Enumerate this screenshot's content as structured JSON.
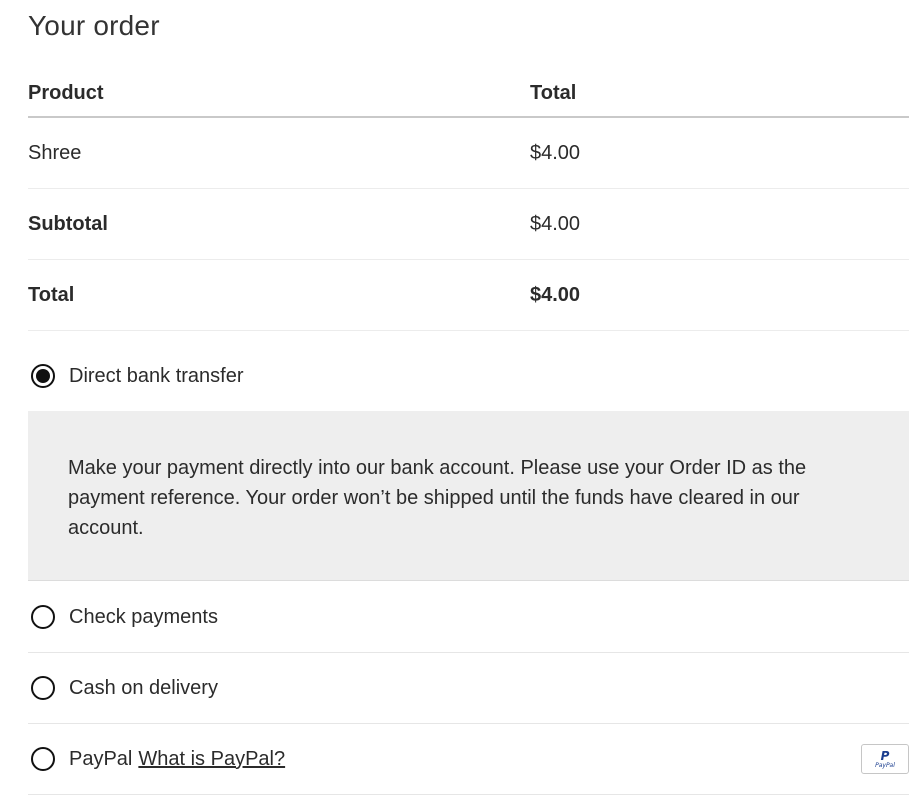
{
  "section_title": "Your order",
  "table": {
    "headers": [
      "Product",
      "Total"
    ],
    "item": {
      "name": "Shree",
      "total": "$4.00"
    },
    "subtotal": {
      "label": "Subtotal",
      "value": "$4.00"
    },
    "total": {
      "label": "Total",
      "value": "$4.00"
    }
  },
  "payment_methods": [
    {
      "label": "Direct bank transfer",
      "selected": true
    },
    {
      "label": "Check payments",
      "selected": false
    },
    {
      "label": "Cash on delivery",
      "selected": false
    },
    {
      "label": "PayPal",
      "selected": false
    }
  ],
  "bank_transfer_description": "Make your payment directly into our bank account. Please use your Order ID as the payment reference. Your order won’t be shipped until the funds have cleared in our account.",
  "paypal": {
    "link_text": "What is PayPal?",
    "logo_text": "PayPal",
    "logo_icon": "paypal-icon"
  }
}
